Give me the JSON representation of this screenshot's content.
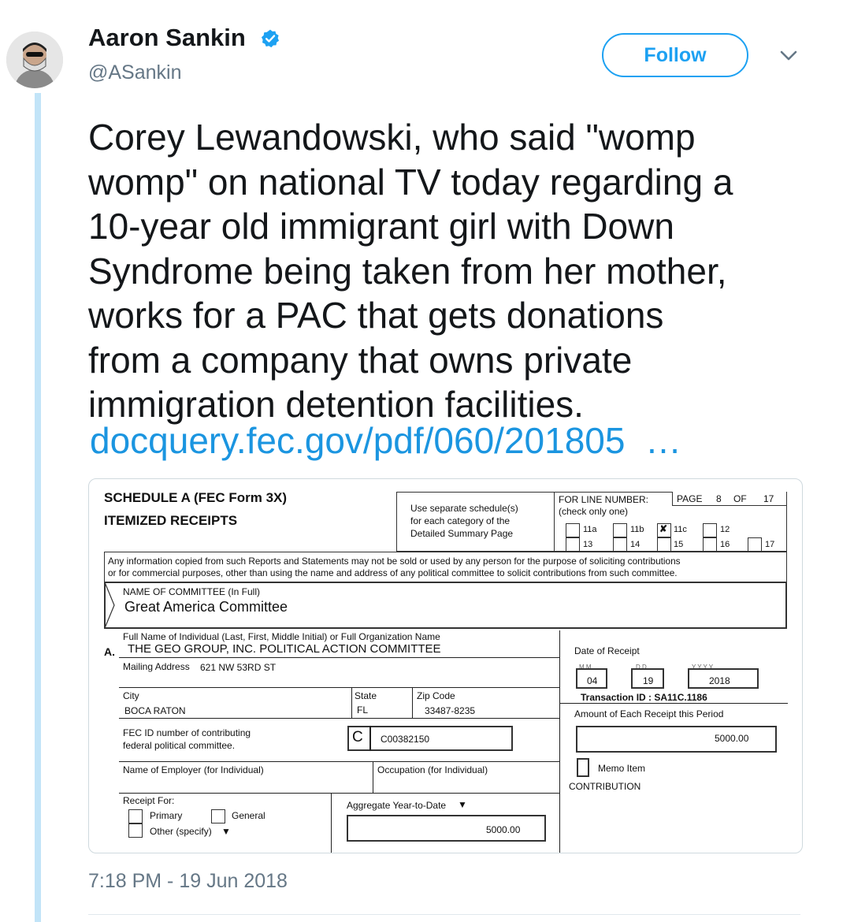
{
  "author": {
    "name": "Aaron Sankin",
    "handle": "@ASankin",
    "verified": true,
    "avatar_icon": "avatar-photo"
  },
  "follow_button": {
    "label": "Follow"
  },
  "tweet": {
    "text": "Corey Lewandowski, who said \"womp\nwomp\" on national TV today regarding a\n10-year old immigrant girl with Down\nSyndrome being taken from her mother,\nworks for a PAC that gets donations\nfrom a company that owns private\nimmigration detention facilities.",
    "link_text": "docquery.fec.gov/pdf/060/201805",
    "link_ellipsis": "…",
    "timestamp": "7:18 PM - 19 Jun 2018"
  },
  "colors": {
    "accent": "#1da1f2",
    "link": "#1b95e0",
    "secondary_text": "#657786",
    "thread_line": "#c2e4f8"
  },
  "form": {
    "title1": "SCHEDULE A  (FEC Form 3X)",
    "title2": "ITEMIZED RECEIPTS",
    "use_separate_1": "Use separate schedule(s)",
    "use_separate_2": "for each category of the",
    "use_separate_3": "Detailed Summary Page",
    "for_line": "FOR LINE NUMBER:",
    "check_only": "(check only one)",
    "page_label": "PAGE",
    "page_num": "8",
    "of_label": "OF",
    "page_total": "17",
    "lines": [
      "11a",
      "11b",
      "11c",
      "12",
      "13",
      "14",
      "15",
      "16",
      "17"
    ],
    "checked_mark": "✘",
    "disclaimer_1": "Any information copied from such Reports and Statements may not be sold or used by any person for the purpose of soliciting contributions",
    "disclaimer_2": "or for commercial purposes, other than using the name and address of any political committee to solicit contributions from such committee.",
    "committee_label": "NAME OF COMMITTEE (In Full)",
    "committee_name": "Great America Committee",
    "section_letter": "A.",
    "full_name_label": "Full Name of Individual (Last, First, Middle Initial) or Full Organization Name",
    "full_name": "THE GEO GROUP, INC. POLITICAL ACTION COMMITTEE",
    "mailing_label": "Mailing Address",
    "mailing_value": "621 NW 53RD ST",
    "city_label": "City",
    "city_value": "BOCA RATON",
    "state_label": "State",
    "state_value": "FL",
    "zip_label": "Zip Code",
    "zip_value": "33487-8235",
    "fec_id_label_1": "FEC ID number of contributing",
    "fec_id_label_2": "federal political committee.",
    "fec_prefix": "C",
    "fec_id_value": "C00382150",
    "employer_label": "Name of Employer (for Individual)",
    "occupation_label": "Occupation (for Individual)",
    "receipt_for": "Receipt For:",
    "primary": "Primary",
    "general": "General",
    "other": "Other (specify)",
    "aggregate_label": "Aggregate Year-to-Date",
    "aggregate_value": "5000.00",
    "date_label": "Date of Receipt",
    "date_mm": "04",
    "date_dd": "19",
    "date_yyyy": "2018",
    "date_mm_hint": "M   M",
    "date_dd_hint": "D   D",
    "date_yy_hint": "Y   Y   Y   Y",
    "transaction_id": "Transaction ID : SA11C.1186",
    "amount_label": "Amount of Each Receipt this Period",
    "amount_value": "5000.00",
    "memo_label": "Memo Item",
    "contribution": "CONTRIBUTION"
  }
}
